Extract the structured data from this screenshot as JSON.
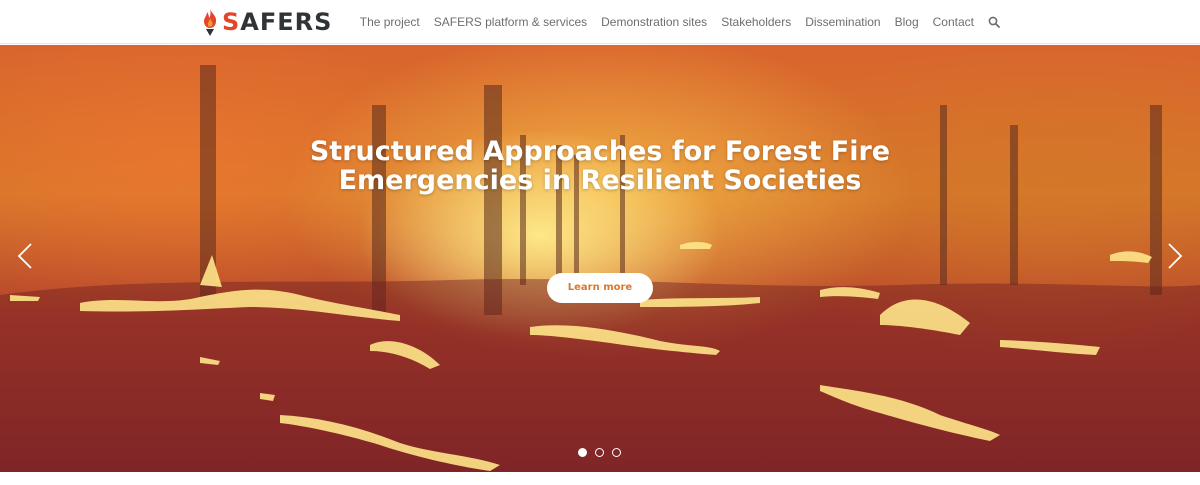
{
  "brand": {
    "name_first_letter": "S",
    "name_rest": "AFERS",
    "accent_color": "#e5442b",
    "text_color": "#2f3437"
  },
  "nav": {
    "items": [
      {
        "label": "The project"
      },
      {
        "label": "SAFERS platform & services"
      },
      {
        "label": "Demonstration sites"
      },
      {
        "label": "Stakeholders"
      },
      {
        "label": "Dissemination"
      },
      {
        "label": "Blog"
      },
      {
        "label": "Contact"
      }
    ],
    "search_icon": "search-icon"
  },
  "hero": {
    "title_line1": "Structured Approaches for Forest Fire",
    "title_line2": "Emergencies in Resilient Societies",
    "button_label": "Learn more",
    "button_text_color": "#d9782a",
    "prev_icon": "chevron-left-icon",
    "next_icon": "chevron-right-icon",
    "slides_count": 3,
    "active_slide": 1
  }
}
